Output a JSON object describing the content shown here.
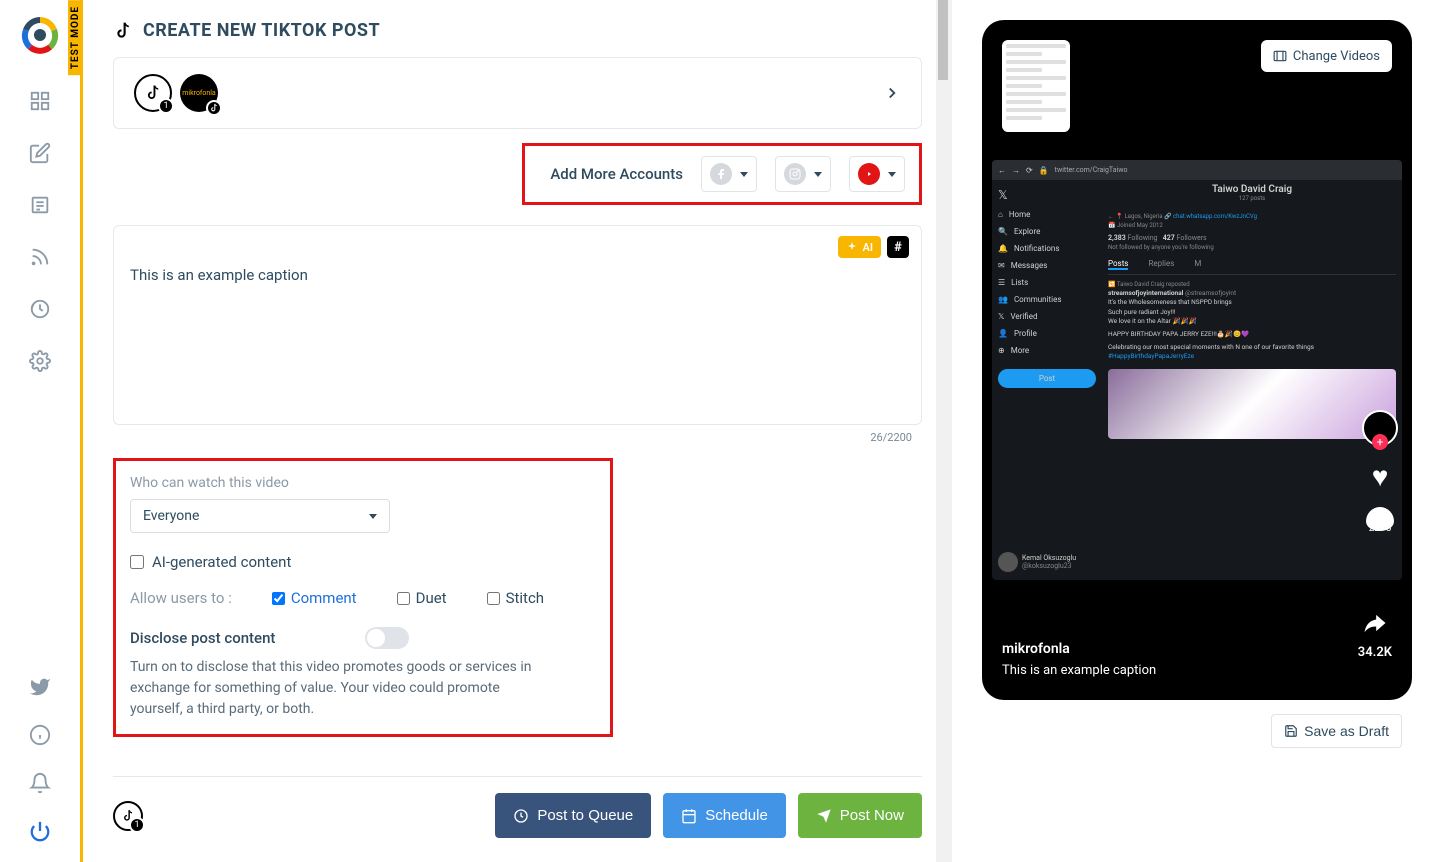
{
  "test_mode_label": "TEST MODE",
  "page_title": "CREATE NEW TIKTOK POST",
  "account_badge_1": "1",
  "add_accounts": {
    "label": "Add More Accounts"
  },
  "caption": {
    "text": "This is an example caption",
    "ai_label": "AI",
    "char_count": "26/2200"
  },
  "settings": {
    "who_watch_label": "Who can watch this video",
    "who_watch_value": "Everyone",
    "ai_content_label": "AI-generated content",
    "allow_label": "Allow users to :",
    "comment_label": "Comment",
    "duet_label": "Duet",
    "stitch_label": "Stitch",
    "disclose_label": "Disclose post content",
    "disclose_desc": "Turn on to disclose that this video promotes goods or services in exchange for something of value. Your video could promote yourself, a third party, or both."
  },
  "footer": {
    "badge": "1",
    "queue_label": "Post to Queue",
    "schedule_label": "Schedule",
    "post_label": "Post Now"
  },
  "preview": {
    "change_videos_label": "Change Videos",
    "browser_url": "twitter.com/CraigTaiwo",
    "tw_nav": [
      "Home",
      "Explore",
      "Notifications",
      "Messages",
      "Lists",
      "Communities",
      "Verified",
      "Profile",
      "More"
    ],
    "tw_post_btn": "Post",
    "tw_user_name": "Kemal Oksuzoglu",
    "tw_user_handle": "@koksuzoglu23",
    "tw_profile_name": "Taiwo David Craig",
    "tw_posts_count": "127 posts",
    "tw_location": "Lagos, Nigeria",
    "tw_link": "chat.whatsapp.com/KwzJnCVg",
    "tw_joined": "Joined May 2012",
    "tw_following": "2,383",
    "tw_following_label": "Following",
    "tw_followers": "427",
    "tw_followers_label": "Followers",
    "tw_notfollowed": "Not followed by anyone you're following",
    "tw_tab_posts": "Posts",
    "tw_tab_replies": "Replies",
    "tw_repost": "Taiwo David Craig reposted",
    "tw_post_author": "streamsofjoyinternational",
    "tw_post_handle": "@streamsofjoyint",
    "tw_post_line1": "It's the Wholesomeness that NSPPD brings",
    "tw_post_line2": "Such pure radiant Joy!!!",
    "tw_post_line3": "We love it on the Altar",
    "tw_post_line4": "HAPPY BIRTHDAY PAPA JERRY EZE!!!",
    "tw_post_line5": "Celebrating our most special moments with N one of our favorite things",
    "tw_post_hashtag": "#HappyBirthdayPapaJerryEze",
    "tiktok_like_count": "2295",
    "share_count": "34.2K",
    "username": "mikrofonla",
    "caption": "This is an example caption"
  },
  "save_draft_label": "Save as Draft"
}
